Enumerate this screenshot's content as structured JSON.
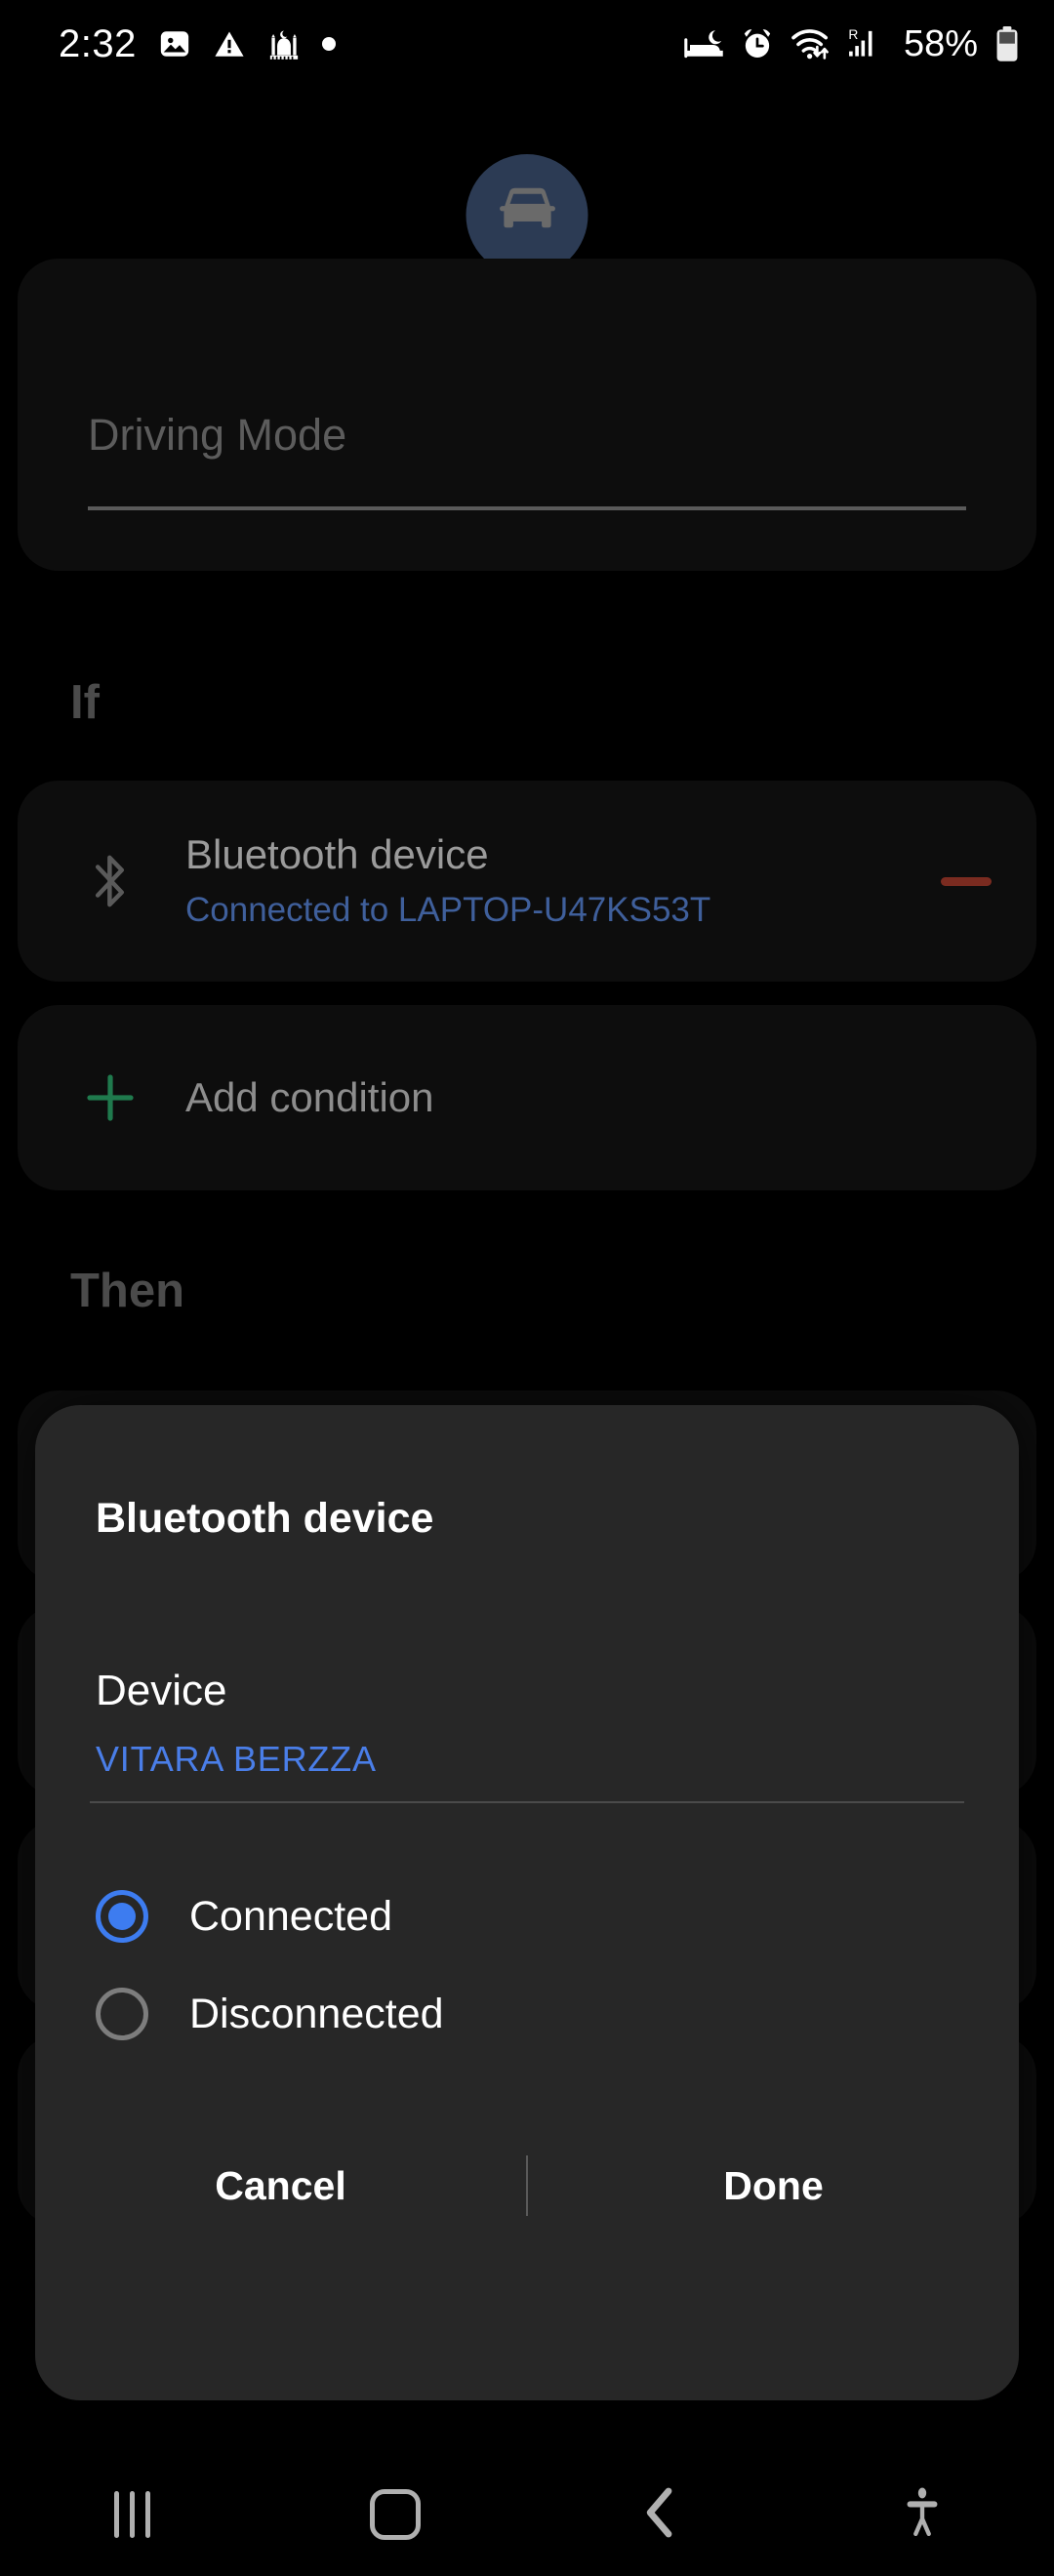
{
  "status_bar": {
    "time": "2:32",
    "left_icons": [
      "image-icon",
      "warning-icon",
      "mosque-icon",
      "dot-icon"
    ],
    "right_icons": [
      "sleep-mode-icon",
      "alarm-icon",
      "wifi-icon",
      "roaming-signal-icon"
    ],
    "battery_percent": "58%",
    "battery_icon": "battery-icon"
  },
  "header": {
    "avatar_icon": "car-icon",
    "avatar_color": "#2c3b54"
  },
  "routine": {
    "name_value": "",
    "name_placeholder": "Driving Mode"
  },
  "sections": {
    "if_label": "If",
    "then_label": "Then"
  },
  "conditions": [
    {
      "icon": "bluetooth-icon",
      "title": "Bluetooth device",
      "subtitle": "Connected to LAPTOP-U47KS53T",
      "subtitle_color": "#3f5f9b",
      "remove_color": "#7a2b20"
    }
  ],
  "add_condition": {
    "icon": "plus-icon",
    "label": "Add condition",
    "icon_color": "#1f7a4d"
  },
  "dialog": {
    "title": "Bluetooth device",
    "device_label": "Device",
    "device_value": "VITARA BERZZA",
    "device_value_color": "#4a7ee8",
    "options": [
      {
        "label": "Connected",
        "selected": true
      },
      {
        "label": "Disconnected",
        "selected": false
      }
    ],
    "cancel_label": "Cancel",
    "done_label": "Done",
    "accent_color": "#3d7cf0"
  },
  "navbar": {
    "recents_label": "recents-icon",
    "home_label": "home-icon",
    "back_label": "back-icon",
    "accessibility_label": "accessibility-icon"
  }
}
